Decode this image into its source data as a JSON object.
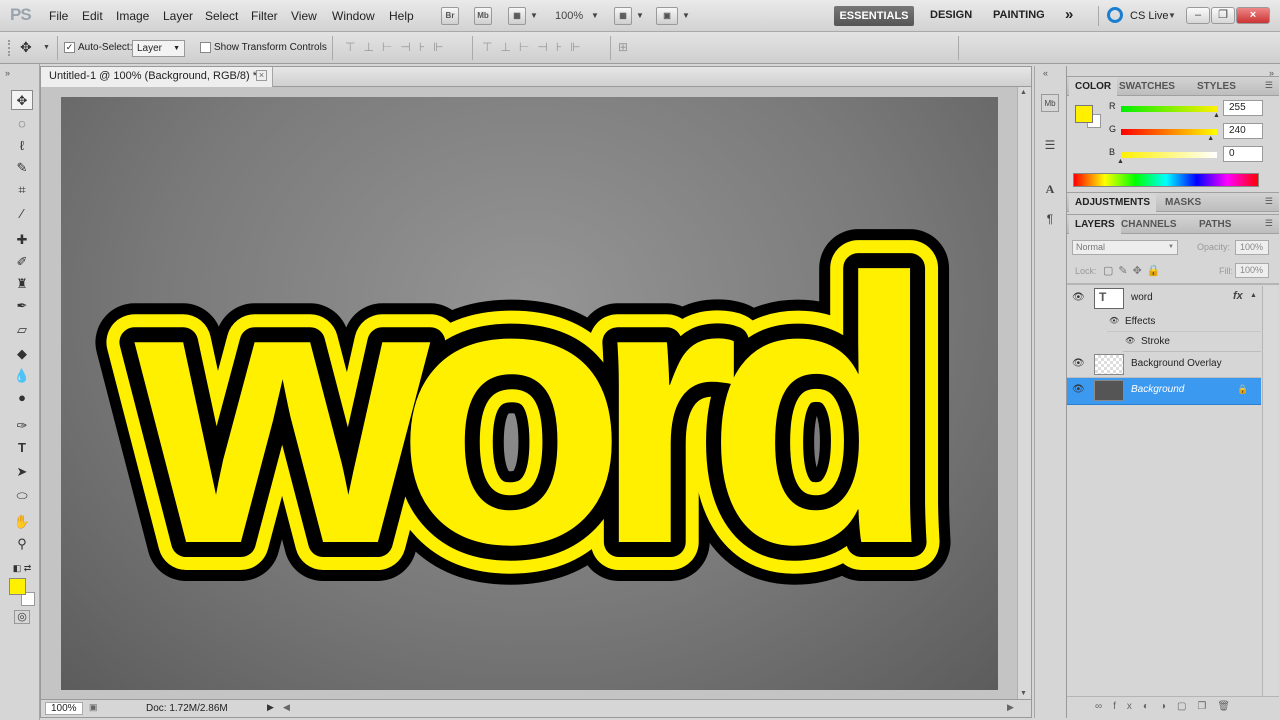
{
  "app": {
    "logo": "PS"
  },
  "menu": [
    "File",
    "Edit",
    "Image",
    "Layer",
    "Select",
    "Filter",
    "View",
    "Window",
    "Help"
  ],
  "app_bar": {
    "bridge": "Br",
    "minibridge": "Mb",
    "zoom": "100%"
  },
  "workspaces": {
    "active": "ESSENTIALS",
    "design": "DESIGN",
    "painting": "PAINTING",
    "more": "»",
    "cslive": "CS Live"
  },
  "options": {
    "auto_select_label": "Auto-Select:",
    "auto_select_checked": true,
    "auto_select_value": "Layer",
    "transform_controls_label": "Show Transform Controls",
    "transform_controls_checked": false
  },
  "document": {
    "tab_title": "Untitled-1 @ 100% (Background, RGB/8) *",
    "close": "×",
    "canvas_text": "word",
    "text_color": "#FFF000",
    "stroke_color": "#000000",
    "zoom": "100%",
    "doc_size": "Doc: 1.72M/2.86M"
  },
  "color_panel": {
    "tabs": [
      "COLOR",
      "SWATCHES",
      "STYLES"
    ],
    "active_tab": "COLOR",
    "foreground": "#FFF000",
    "channels": [
      {
        "label": "R",
        "value": "255",
        "level": 1.0
      },
      {
        "label": "G",
        "value": "240",
        "level": 0.94
      },
      {
        "label": "B",
        "value": "0",
        "level": 0.0
      }
    ]
  },
  "adjustments_panel": {
    "tabs": [
      "ADJUSTMENTS",
      "MASKS"
    ]
  },
  "layers_panel": {
    "tabs": [
      "LAYERS",
      "CHANNELS",
      "PATHS"
    ],
    "blend_mode": "Normal",
    "opacity_label": "Opacity:",
    "opacity": "100%",
    "lock_label": "Lock:",
    "fill_label": "Fill:",
    "fill": "100%",
    "layers": [
      {
        "name": "word",
        "fx": "fx",
        "effects_label": "Effects",
        "effect": "Stroke"
      },
      {
        "name": "Background Overlay"
      },
      {
        "name": "Background",
        "selected": true
      }
    ]
  }
}
